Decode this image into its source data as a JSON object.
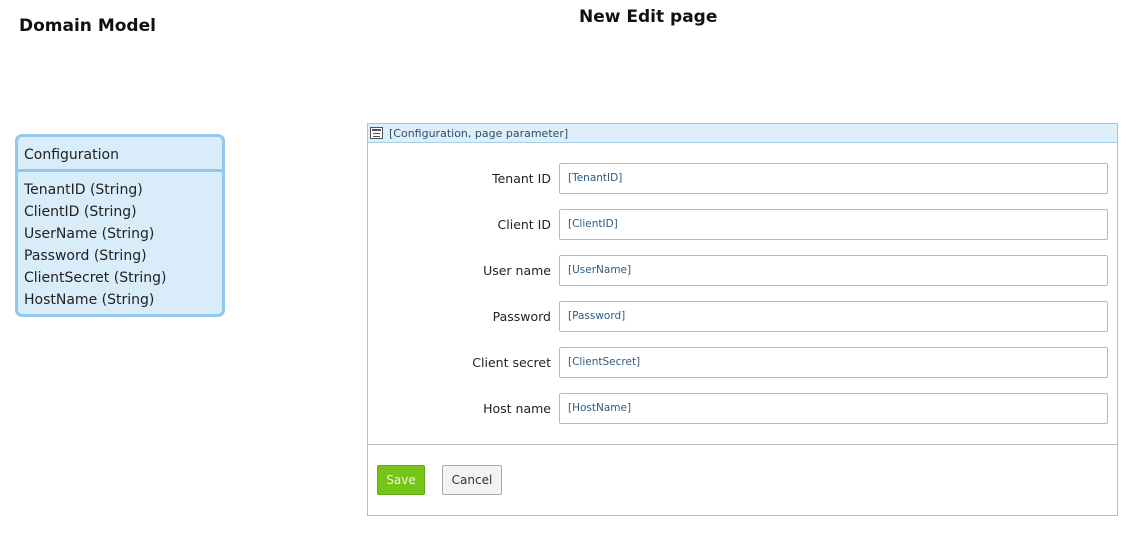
{
  "headings": {
    "domain_model": "Domain Model",
    "new_edit_page": "New Edit page"
  },
  "entity": {
    "name": "Configuration",
    "attributes": [
      "TenantID (String)",
      "ClientID (String)",
      "UserName (String)",
      "Password (String)",
      "ClientSecret (String)",
      "HostName (String)"
    ]
  },
  "dataview": {
    "title": "[Configuration, page parameter]",
    "icon": "dataview-icon",
    "fields": [
      {
        "label": "Tenant ID",
        "value": "[TenantID]"
      },
      {
        "label": "Client ID",
        "value": "[ClientID]"
      },
      {
        "label": "User name",
        "value": "[UserName]"
      },
      {
        "label": "Password",
        "value": "[Password]"
      },
      {
        "label": "Client secret",
        "value": "[ClientSecret]"
      },
      {
        "label": "Host name",
        "value": "[HostName]"
      }
    ],
    "buttons": {
      "save": "Save",
      "cancel": "Cancel"
    }
  },
  "colors": {
    "entity_fill": "#d8ecfa",
    "entity_border": "#93c8ea",
    "save_button": "#77c419",
    "header_fill": "#dfeff9"
  }
}
